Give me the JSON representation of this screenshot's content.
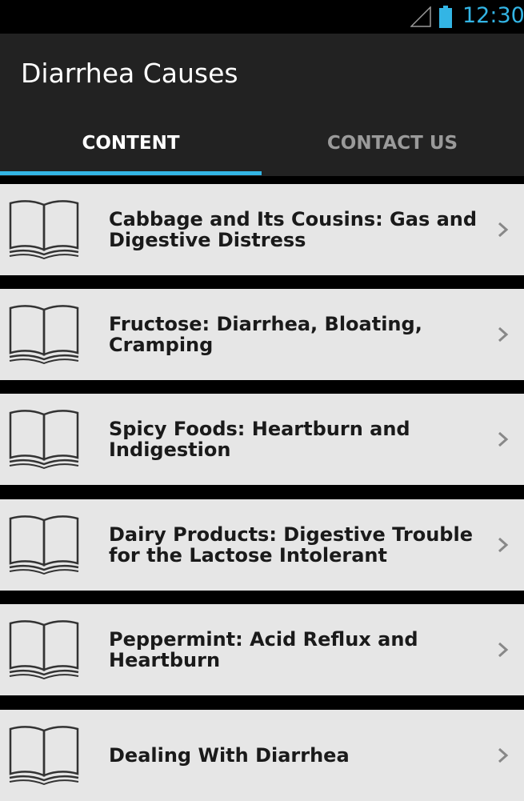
{
  "status_bar": {
    "time": "12:30",
    "signal_icon": "signal-icon",
    "battery_icon": "battery-icon",
    "accent_color": "#33b5e5"
  },
  "action_bar": {
    "title": "Diarrhea Causes",
    "tabs": [
      {
        "label": "CONTENT",
        "selected": true
      },
      {
        "label": "CONTACT US",
        "selected": false
      }
    ]
  },
  "list": {
    "items": [
      {
        "label": "Cabbage and Its Cousins: Gas and Digestive Distress",
        "icon": "book-icon"
      },
      {
        "label": "Fructose: Diarrhea, Bloating, Cramping",
        "icon": "book-icon"
      },
      {
        "label": "Spicy Foods: Heartburn and Indigestion",
        "icon": "book-icon"
      },
      {
        "label": "Dairy Products: Digestive Trouble for the Lactose Intolerant",
        "icon": "book-icon"
      },
      {
        "label": "Peppermint: Acid Reflux and Heartburn",
        "icon": "book-icon"
      },
      {
        "label": "Dealing With Diarrhea",
        "icon": "book-icon"
      }
    ]
  }
}
